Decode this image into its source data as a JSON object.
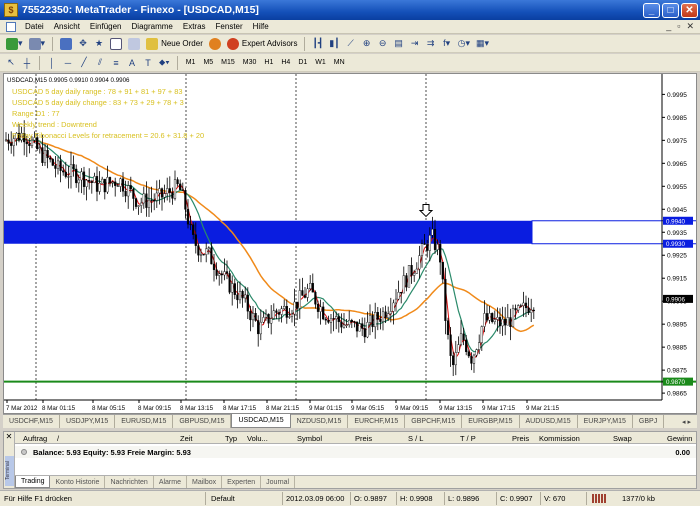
{
  "window": {
    "title": "75522350: MetaTrader - Finexo - [USDCAD,M15]",
    "buttons": {
      "minimize": "_",
      "maximize": "□",
      "close": "✕"
    }
  },
  "menu": {
    "items": [
      "Datei",
      "Ansicht",
      "Einfügen",
      "Diagramme",
      "Extras",
      "Fenster",
      "Hilfe"
    ],
    "mdi_controls": [
      "_",
      "▫",
      "✕"
    ]
  },
  "toolbar": {
    "new_order": "Neue Order",
    "expert_advisors": "Expert Advisors",
    "timeframes": [
      "M1",
      "M5",
      "M15",
      "M30",
      "H1",
      "H4",
      "D1",
      "W1",
      "MN"
    ]
  },
  "chart": {
    "header": "USDCAD,M15  0.9905 0.9910 0.9904 0.9906",
    "annotations": [
      "USDCAD 5 day daily range : 78 + 91 + 81 + 97 + 83",
      "USDCAD 5 day daily change : 83 + 73 + 29 + 78 + 3",
      "Range D1 : 77",
      "Weekly trend : Downtrend",
      "Friday Fibonacci Levels for retracement = 20.6 + 31.8 + 20"
    ],
    "price_labels": [
      "0.9995",
      "0.9985",
      "0.9975",
      "0.9965",
      "0.9955",
      "0.9945",
      "0.9935",
      "0.9925",
      "0.9915",
      "0.9905",
      "0.9895",
      "0.9885",
      "0.9875",
      "0.9865"
    ],
    "time_labels": [
      "7 Mar 2012",
      "8 Mar 01:15",
      "8 Mar 05:15",
      "8 Mar 09:15",
      "8 Mar 13:15",
      "8 Mar 17:15",
      "8 Mar 21:15",
      "9 Mar 01:15",
      "9 Mar 05:15",
      "9 Mar 09:15",
      "9 Mar 13:15",
      "9 Mar 17:15",
      "9 Mar 21:15"
    ],
    "hline_labels": {
      "zone_top": "0.9940",
      "zone_bottom": "0.9930",
      "current": "0.9906",
      "support": "0.9870"
    },
    "colors": {
      "zone": "#0a1de0",
      "support": "#1a8a1a",
      "ma_slow": "#f08a1a",
      "ma_fast": "#2a8a6a",
      "candle": "#000000",
      "wick_red": "#e01010",
      "annotation": "#d8c020"
    },
    "price_min": 0.9862,
    "price_max": 1.0003,
    "zone": {
      "high": 0.994,
      "low": 0.993
    },
    "support_level": 0.987,
    "last_price": 0.9906
  },
  "symbol_tabs": [
    "USDCHF,M15",
    "USDJPY,M15",
    "EURUSD,M15",
    "GBPUSD,M15",
    "USDCAD,M15",
    "NZDUSD,M15",
    "EURCHF,M15",
    "GBPCHF,M15",
    "EURGBP,M15",
    "AUDUSD,M15",
    "EURJPY,M15",
    "GBPJ"
  ],
  "symbol_tabs_active": "USDCAD,M15",
  "terminal": {
    "columns": [
      "Auftrag",
      "/",
      "Zeit",
      "Typ",
      "Volu...",
      "Symbol",
      "Preis",
      "S / L",
      "T / P",
      "Preis",
      "Kommission",
      "Swap",
      "Gewinn"
    ],
    "balance_line": "Balance: 5.93  Equity: 5.93  Freie Margin: 5.93",
    "balance_total": "0.00",
    "tabs": [
      "Trading",
      "Konto Historie",
      "Nachrichten",
      "Alarme",
      "Mailbox",
      "Experten",
      "Journal"
    ],
    "side_label": "Terminal",
    "close": "✕"
  },
  "status": {
    "help": "Für Hilfe F1 drücken",
    "profile": "Default",
    "datetime": "2012.03.09 06:00",
    "open": "O: 0.9897",
    "high": "H: 0.9908",
    "low": "L: 0.9896",
    "close": "C: 0.9907",
    "volume": "V: 670",
    "traffic": "1377/0 kb"
  }
}
